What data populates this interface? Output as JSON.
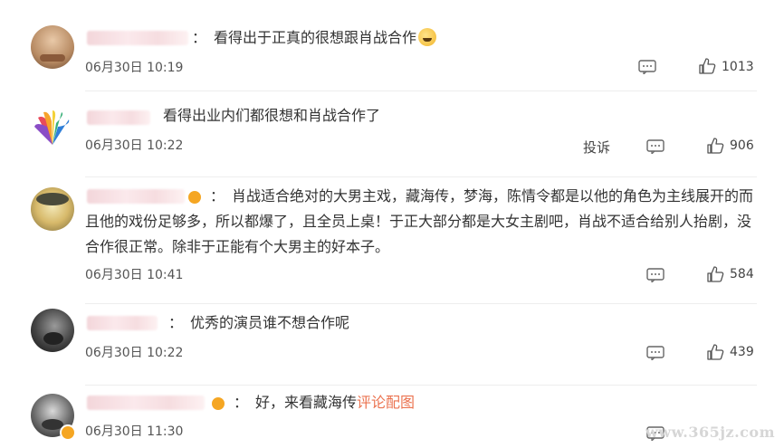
{
  "comments": [
    {
      "text": "看得出于正真的很想跟肖战合作",
      "time": "06月30日 10:19",
      "likes": "1013",
      "has_report": false,
      "emoji": "laugh-cry-emoji"
    },
    {
      "text": "看得出业内们都很想和肖战合作了",
      "time": "06月30日 10:22",
      "likes": "906",
      "has_report": true,
      "report_label": "投诉"
    },
    {
      "lines": [
        "肖战适合绝对的大男主戏，藏海传，梦海，陈情令都是以他的角色为主线展开的而",
        "且他的戏份足够多，所以都爆了，且全员上桌！于正大部分都是大女主剧吧，肖战不适合给别人抬剧，没",
        "合作很正常。除非于正能有个大男主的好本子。"
      ],
      "time": "06月30日 10:41",
      "likes": "584",
      "has_report": false
    },
    {
      "text": "优秀的演员谁不想合作呢",
      "time": "06月30日 10:22",
      "likes": "439",
      "has_report": false
    },
    {
      "text": "好，来看藏海传",
      "link": "评论配图",
      "time": "06月30日 11:30",
      "likes": "",
      "has_report": false
    }
  ],
  "colon": "：",
  "watermark": "www.365jz.com",
  "colors": {
    "text": "#333333",
    "link": "#eb7350",
    "meta": "#555555",
    "divider": "#eeeeee"
  }
}
